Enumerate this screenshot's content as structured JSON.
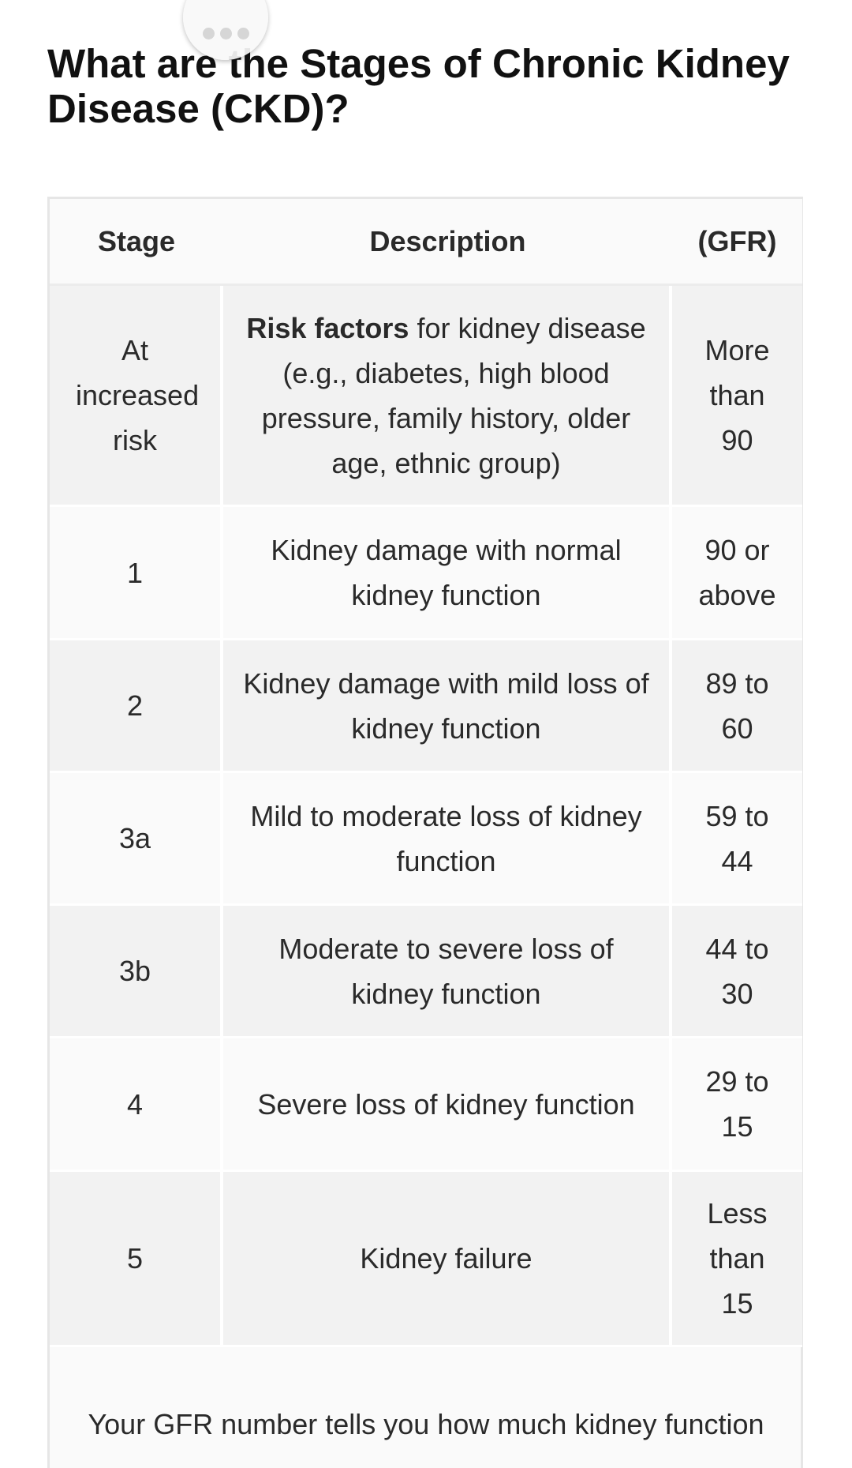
{
  "menu": {
    "more_icon": "more-horizontal-icon"
  },
  "title": "What are the Stages of Chronic Kidney Disease (CKD)?",
  "table": {
    "headers": {
      "stage": "Stage",
      "description": "Description",
      "gfr": "(GFR)"
    },
    "rows": [
      {
        "stage": "At increased risk",
        "description_bold": "Risk factors",
        "description": " for kidney disease (e.g., diabetes, high blood pressure, family history, older age, ethnic group)",
        "gfr": "More than 90"
      },
      {
        "stage": "1",
        "description": "Kidney damage with normal kidney function",
        "gfr": "90 or above"
      },
      {
        "stage": "2",
        "description": "Kidney damage with mild loss of kidney function",
        "gfr": "89 to 60"
      },
      {
        "stage": "3a",
        "description": "Mild to moderate loss of kidney function",
        "gfr": "59 to 44"
      },
      {
        "stage": "3b",
        "description": "Moderate to severe loss of kidney function",
        "gfr": "44 to 30"
      },
      {
        "stage": "4",
        "description": "Severe loss of kidney function",
        "gfr": "29 to 15"
      },
      {
        "stage": "5",
        "description": "Kidney failure",
        "gfr": "Less than 15"
      }
    ],
    "footer": "Your GFR number tells you how much kidney function"
  }
}
